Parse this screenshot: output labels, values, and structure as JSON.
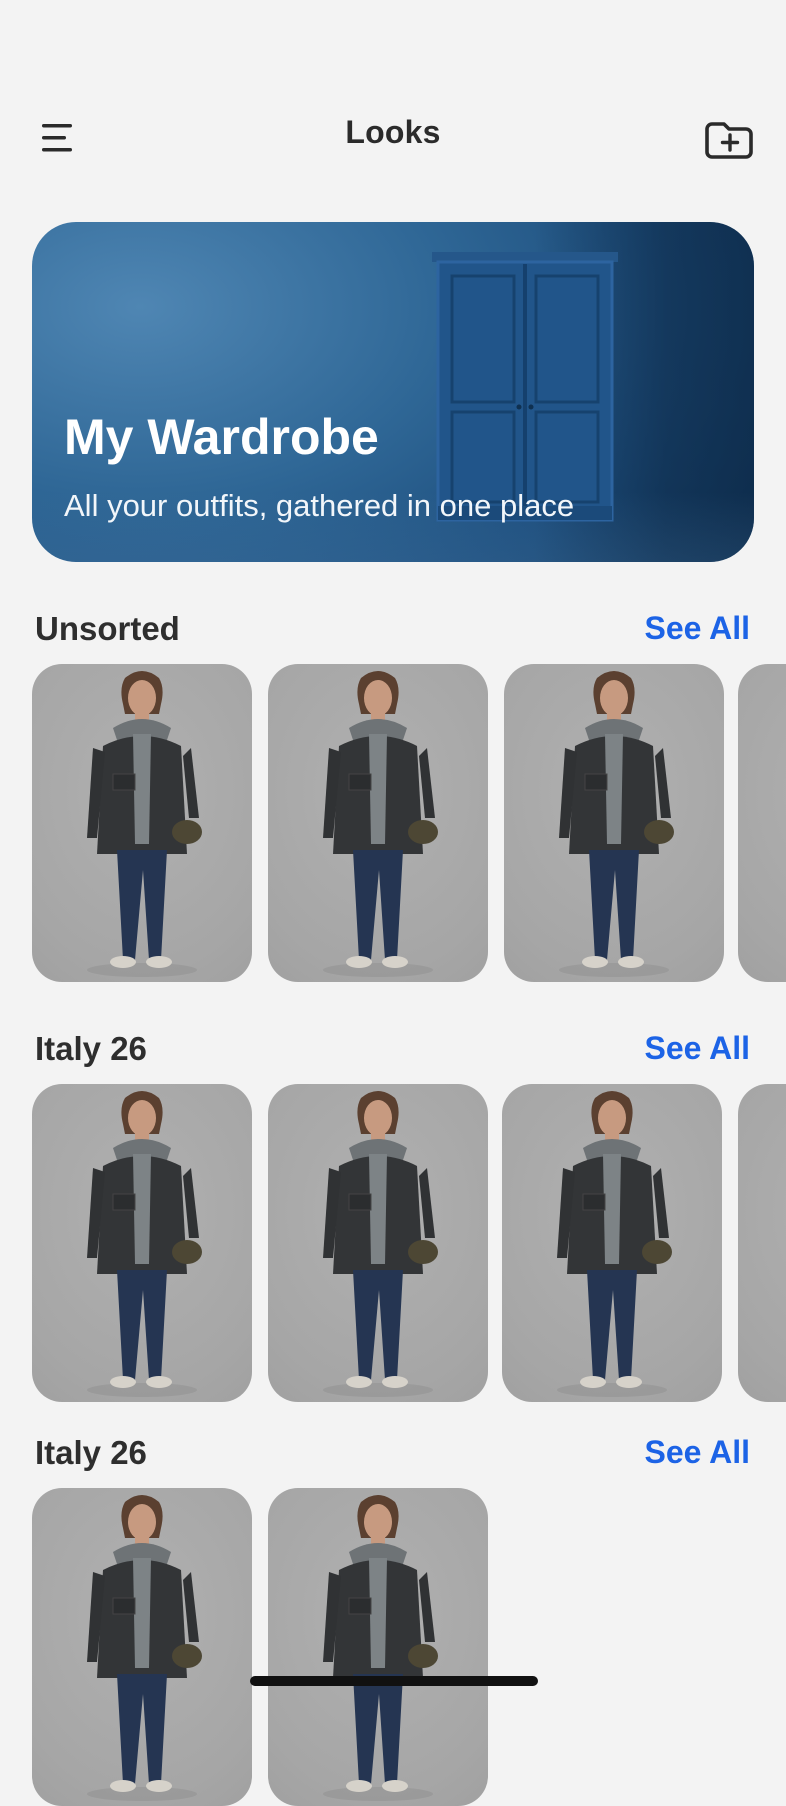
{
  "header": {
    "title": "Looks",
    "menu_icon": "hamburger-menu-icon",
    "add_icon": "folder-plus-icon"
  },
  "hero": {
    "title": "My Wardrobe",
    "subtitle": "All your outfits, gathered in one place",
    "illustration": "wardrobe-illustration"
  },
  "sections": [
    {
      "title": "Unsorted",
      "see_all_label": "See All",
      "visible_looks": 4
    },
    {
      "title": "Italy 26",
      "see_all_label": "See All",
      "visible_looks": 4
    },
    {
      "title": "Italy 26",
      "see_all_label": "See All",
      "visible_looks": 2
    }
  ],
  "colors": {
    "background": "#f3f3f3",
    "accent": "#1c63e6",
    "hero_blue": "#2f6796",
    "card_gray": "#a8a8a8"
  }
}
